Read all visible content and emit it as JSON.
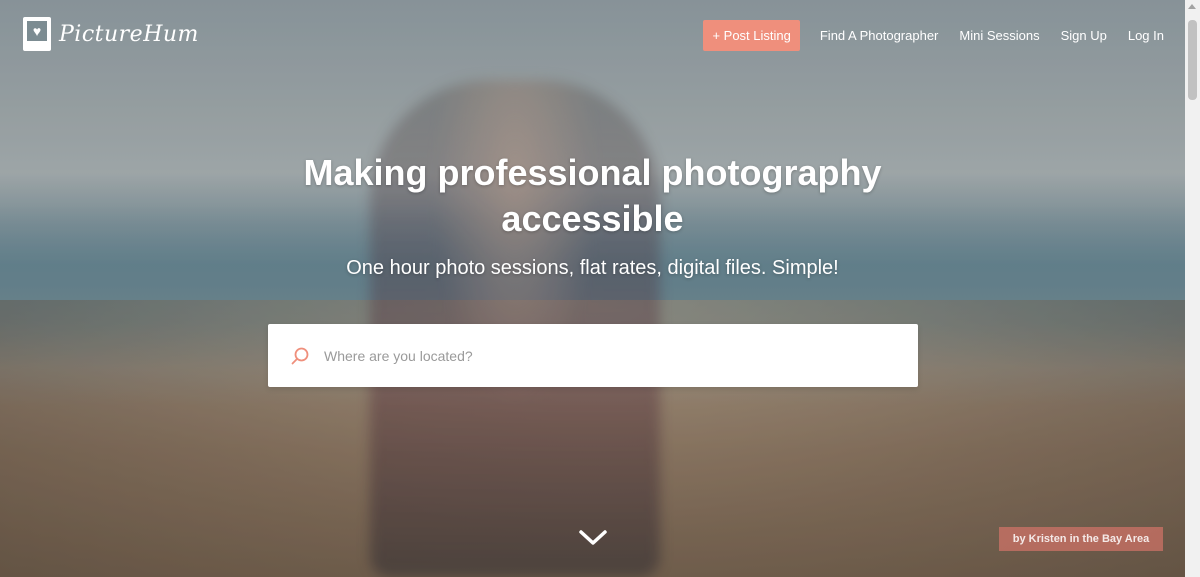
{
  "brand": {
    "name": "PictureHum"
  },
  "nav": {
    "post_listing": "+ Post Listing",
    "links": [
      "Find A Photographer",
      "Mini Sessions",
      "Sign Up",
      "Log In"
    ]
  },
  "hero": {
    "title_line1": "Making professional photography",
    "title_line2": "accessible",
    "subtitle": "One hour photo sessions, flat rates, digital files. Simple!"
  },
  "search": {
    "placeholder": "Where are you located?"
  },
  "credit": "by Kristen in the Bay Area",
  "colors": {
    "accent": "#ef8f7c",
    "white": "#ffffff"
  }
}
